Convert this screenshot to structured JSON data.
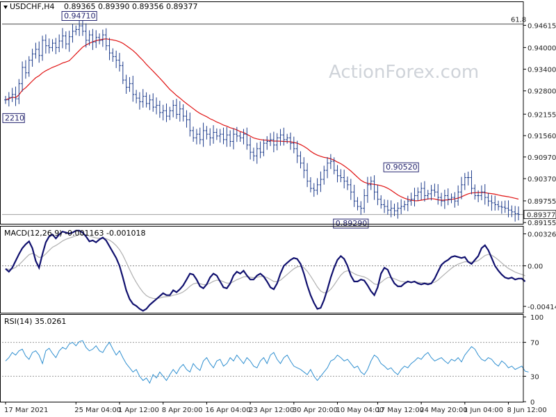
{
  "chart_data": {
    "type": "candlestick",
    "symbol_header": "USDCHF,H4",
    "ohlc_header": "0.89365 0.89390 0.89356 0.89377",
    "watermark": "ActionForex.com",
    "fib_label": "61.8",
    "fib_level": 0.9465,
    "current_price": 0.89377,
    "current_price_label": "0.89377",
    "price_ticks": [
      "0.94615",
      "0.94000",
      "0.93400",
      "0.92800",
      "0.92155",
      "0.91560",
      "0.90970",
      "0.90370",
      "0.89755",
      "0.89155"
    ],
    "price_tick_values": [
      0.94615,
      0.94,
      0.934,
      0.928,
      0.92155,
      0.9156,
      0.9097,
      0.9037,
      0.89755,
      0.89155
    ],
    "ylim": [
      0.8912,
      0.9495
    ],
    "annotations": [
      {
        "text": "0.94710",
        "price": 0.9471,
        "bar": 22
      },
      {
        "text": "2210",
        "price": 0.9221,
        "bar": 1
      },
      {
        "text": "0.89290",
        "price": 0.8929,
        "bar": 103
      },
      {
        "text": "0.90520",
        "price": 0.9052,
        "bar": 118
      }
    ],
    "x_labels": [
      "17 Mar 2021",
      "25 Mar 04:00",
      "1 Apr 12:00",
      "8 Apr 20:00",
      "16 Apr 04:00",
      "23 Apr 12:00",
      "30 Apr 20:00",
      "10 May 04:00",
      "17 May 12:00",
      "24 May 20:00",
      "1 Jun 04:00",
      "8 Jun 12:00"
    ],
    "x_label_bars": [
      0,
      21,
      34,
      47,
      60,
      73,
      86,
      99,
      111,
      124,
      137,
      150
    ],
    "closes": [
      0.9255,
      0.9262,
      0.927,
      0.9258,
      0.93,
      0.9345,
      0.933,
      0.9365,
      0.9382,
      0.9395,
      0.9378,
      0.942,
      0.9405,
      0.94,
      0.9412,
      0.94,
      0.9418,
      0.9432,
      0.941,
      0.943,
      0.9445,
      0.945,
      0.946,
      0.9445,
      0.942,
      0.9435,
      0.9415,
      0.9428,
      0.942,
      0.9435,
      0.9405,
      0.9385,
      0.9375,
      0.9365,
      0.935,
      0.931,
      0.929,
      0.93,
      0.927,
      0.926,
      0.925,
      0.9265,
      0.9245,
      0.9255,
      0.9235,
      0.924,
      0.922,
      0.9225,
      0.921,
      0.9225,
      0.924,
      0.9215,
      0.923,
      0.921,
      0.92,
      0.917,
      0.915,
      0.916,
      0.9145,
      0.917,
      0.916,
      0.915,
      0.9165,
      0.9155,
      0.916,
      0.9145,
      0.9158,
      0.914,
      0.916,
      0.9155,
      0.915,
      0.916,
      0.913,
      0.911,
      0.91,
      0.912,
      0.911,
      0.9135,
      0.914,
      0.9145,
      0.913,
      0.915,
      0.9158,
      0.9145,
      0.915,
      0.9135,
      0.912,
      0.91,
      0.908,
      0.906,
      0.903,
      0.901,
      0.9005,
      0.902,
      0.9035,
      0.906,
      0.908,
      0.9085,
      0.906,
      0.9045,
      0.904,
      0.903,
      0.902,
      0.9,
      0.8975,
      0.896,
      0.8955,
      0.899,
      0.902,
      0.903,
      0.9,
      0.898,
      0.8965,
      0.896,
      0.895,
      0.8955,
      0.8948,
      0.8955,
      0.896,
      0.8965,
      0.8975,
      0.898,
      0.899,
      0.9,
      0.901,
      0.899,
      0.8995,
      0.9005,
      0.9,
      0.8985,
      0.8975,
      0.899,
      0.898,
      0.8985,
      0.8975,
      0.9,
      0.902,
      0.904,
      0.904,
      0.901,
      0.899,
      0.899,
      0.9,
      0.8985,
      0.8975,
      0.897,
      0.8965,
      0.896,
      0.8958,
      0.8955,
      0.895,
      0.8945,
      0.894,
      0.8938
    ],
    "ma_color": "#e01010",
    "candle_color": "#1b3a8a",
    "macd": {
      "label": "MACD(12,26,9) -0.001163 -0.001018",
      "ticks": [
        "0.003268",
        "0.00",
        "-0.004144"
      ],
      "tick_values": [
        0.003268,
        0.0,
        -0.004144
      ],
      "ylim": [
        -0.0048,
        0.0038
      ],
      "line_color": "#10106e",
      "signal_color": "#b0b0b0",
      "line": [
        -0.0003,
        -0.0006,
        -0.0002,
        0.0005,
        0.0012,
        0.0018,
        0.0022,
        0.0025,
        0.0018,
        0.0005,
        -0.0002,
        0.0012,
        0.0024,
        0.003,
        0.0032,
        0.0028,
        0.0032,
        0.0035,
        0.0034,
        0.0033,
        0.0034,
        0.0036,
        0.0036,
        0.0034,
        0.003,
        0.0025,
        0.0026,
        0.0024,
        0.0027,
        0.0029,
        0.0026,
        0.002,
        0.0014,
        0.0008,
        0.0,
        -0.0012,
        -0.0025,
        -0.0034,
        -0.0039,
        -0.0041,
        -0.0044,
        -0.0046,
        -0.0044,
        -0.004,
        -0.0037,
        -0.0034,
        -0.0031,
        -0.0028,
        -0.003,
        -0.003,
        -0.0025,
        -0.0027,
        -0.0024,
        -0.002,
        -0.0014,
        -0.0008,
        -0.0009,
        -0.0014,
        -0.0021,
        -0.0023,
        -0.0019,
        -0.0012,
        -0.0008,
        -0.001,
        -0.0016,
        -0.0022,
        -0.0023,
        -0.0018,
        -0.001,
        -0.0006,
        -0.0008,
        -0.0005,
        -0.001,
        -0.0014,
        -0.0014,
        -0.001,
        -0.0008,
        -0.0011,
        -0.0016,
        -0.0022,
        -0.0024,
        -0.0018,
        -0.0008,
        0.0,
        0.0003,
        0.0006,
        0.0008,
        0.0007,
        0.0002,
        -0.0008,
        -0.002,
        -0.003,
        -0.0038,
        -0.0044,
        -0.0043,
        -0.0035,
        -0.0024,
        -0.0012,
        -0.0002,
        0.0006,
        0.001,
        0.0007,
        0.0,
        -0.001,
        -0.0016,
        -0.0016,
        -0.0014,
        -0.0015,
        -0.002,
        -0.0026,
        -0.003,
        -0.0022,
        -0.0008,
        -0.0002,
        -0.0004,
        -0.0012,
        -0.0018,
        -0.0021,
        -0.0021,
        -0.0018,
        -0.0016,
        -0.0017,
        -0.0016,
        -0.0018,
        -0.0019,
        -0.0018,
        -0.0019,
        -0.0018,
        -0.0013,
        -0.0006,
        0.0001,
        0.0004,
        0.0006,
        0.0009,
        0.001,
        0.0009,
        0.0008,
        0.0009,
        0.0004,
        0.0002,
        0.0006,
        0.001,
        0.0018,
        0.0021,
        0.0016,
        0.0008,
        0.0,
        -0.0005,
        -0.0009,
        -0.0012,
        -0.0013,
        -0.0012,
        -0.0014,
        -0.0013,
        -0.0013,
        -0.0016
      ]
    },
    "rsi": {
      "label": "RSI(14) 35.0261",
      "ticks": [
        "100",
        "70",
        "30",
        "0"
      ],
      "tick_values": [
        100,
        70,
        30,
        0
      ],
      "levels": [
        70,
        30
      ],
      "ylim": [
        0,
        100
      ],
      "line_color": "#2f8fd0",
      "values": [
        48,
        52,
        58,
        55,
        60,
        62,
        54,
        50,
        58,
        60,
        55,
        45,
        60,
        63,
        57,
        52,
        60,
        64,
        62,
        68,
        70,
        66,
        71,
        72,
        64,
        60,
        62,
        66,
        60,
        58,
        65,
        70,
        62,
        55,
        60,
        52,
        45,
        40,
        35,
        38,
        30,
        25,
        28,
        22,
        32,
        28,
        35,
        30,
        25,
        32,
        38,
        33,
        40,
        44,
        38,
        35,
        45,
        40,
        37,
        48,
        52,
        45,
        40,
        48,
        50,
        42,
        45,
        52,
        48,
        55,
        50,
        45,
        52,
        48,
        42,
        40,
        48,
        52,
        45,
        55,
        58,
        50,
        45,
        52,
        55,
        48,
        42,
        40,
        38,
        35,
        32,
        38,
        30,
        25,
        30,
        35,
        40,
        48,
        50,
        55,
        52,
        48,
        50,
        45,
        40,
        42,
        35,
        32,
        38,
        48,
        55,
        52,
        45,
        42,
        38,
        40,
        35,
        32,
        38,
        42,
        40,
        45,
        48,
        52,
        50,
        55,
        58,
        52,
        48,
        50,
        52,
        48,
        45,
        50,
        48,
        52,
        47,
        55,
        60,
        65,
        62,
        55,
        50,
        48,
        52,
        50,
        45,
        42,
        48,
        45,
        40,
        42,
        38,
        40,
        42,
        36,
        35
      ]
    }
  }
}
